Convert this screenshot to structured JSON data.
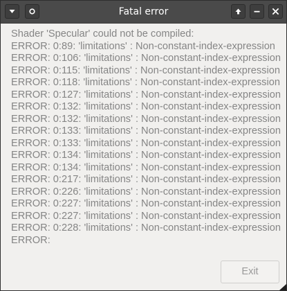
{
  "window": {
    "title": "Fatal error"
  },
  "titlebar": {
    "left_buttons": [
      {
        "icon": "menu-triangle-icon"
      },
      {
        "icon": "circle-icon"
      }
    ],
    "right_buttons": [
      {
        "icon": "arrow-up-icon"
      },
      {
        "icon": "minimize-icon"
      },
      {
        "icon": "close-icon"
      }
    ]
  },
  "message": {
    "lines": [
      "Shader 'Specular' could not be compiled:",
      "ERROR: 0:89: 'limitations' : Non-constant-index-expression",
      "ERROR: 0:106: 'limitations' : Non-constant-index-expression",
      "ERROR: 0:115: 'limitations' : Non-constant-index-expression",
      "ERROR: 0:118: 'limitations' : Non-constant-index-expression",
      "ERROR: 0:127: 'limitations' : Non-constant-index-expression",
      "ERROR: 0:132: 'limitations' : Non-constant-index-expression",
      "ERROR: 0:132: 'limitations' : Non-constant-index-expression",
      "ERROR: 0:133: 'limitations' : Non-constant-index-expression",
      "ERROR: 0:133: 'limitations' : Non-constant-index-expression",
      "ERROR: 0:134: 'limitations' : Non-constant-index-expression",
      "ERROR: 0:134: 'limitations' : Non-constant-index-expression",
      "ERROR: 0:217: 'limitations' : Non-constant-index-expression",
      "ERROR: 0:226: 'limitations' : Non-constant-index-expression",
      "ERROR: 0:227: 'limitations' : Non-constant-index-expression",
      "ERROR: 0:227: 'limitations' : Non-constant-index-expression",
      "ERROR: 0:228: 'limitations' : Non-constant-index-expression",
      "ERROR:"
    ]
  },
  "footer": {
    "exit_label": "Exit"
  },
  "colors": {
    "titlebar": "#4a4a4a",
    "body": "#f1f0ee",
    "text": "#858585"
  }
}
